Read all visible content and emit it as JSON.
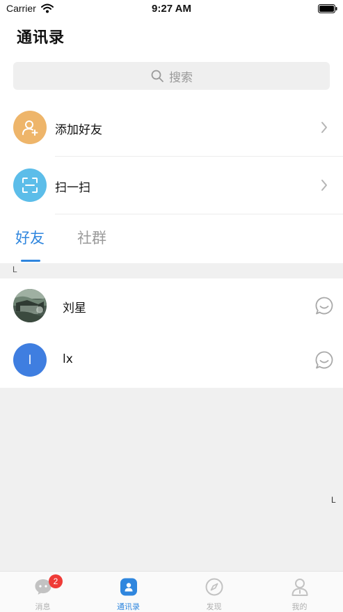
{
  "status_bar": {
    "carrier": "Carrier",
    "time": "9:27 AM"
  },
  "page": {
    "title": "通讯录"
  },
  "search": {
    "placeholder": "搜索"
  },
  "menu": [
    {
      "label": "添加好友",
      "icon": "add-user-icon",
      "color": "#eeb56a"
    },
    {
      "label": "扫一扫",
      "icon": "scan-icon",
      "color": "#5cbde9"
    }
  ],
  "tabs": [
    {
      "label": "好友",
      "active": true
    },
    {
      "label": "社群",
      "active": false
    }
  ],
  "section": {
    "letter": "L"
  },
  "contacts": [
    {
      "name": "刘星",
      "avatar": "photo"
    },
    {
      "name": "lx",
      "avatar_letter": "l",
      "avatar_color": "#3f7ee0"
    }
  ],
  "index": {
    "letter": "L"
  },
  "tab_bar": {
    "items": [
      {
        "label": "消息",
        "icon": "message-icon",
        "badge": "2"
      },
      {
        "label": "通讯录",
        "icon": "contacts-icon",
        "active": true
      },
      {
        "label": "发现",
        "icon": "compass-icon"
      },
      {
        "label": "我的",
        "icon": "profile-icon"
      }
    ]
  },
  "colors": {
    "accent": "#2f86de",
    "badge": "#ef3b37"
  }
}
